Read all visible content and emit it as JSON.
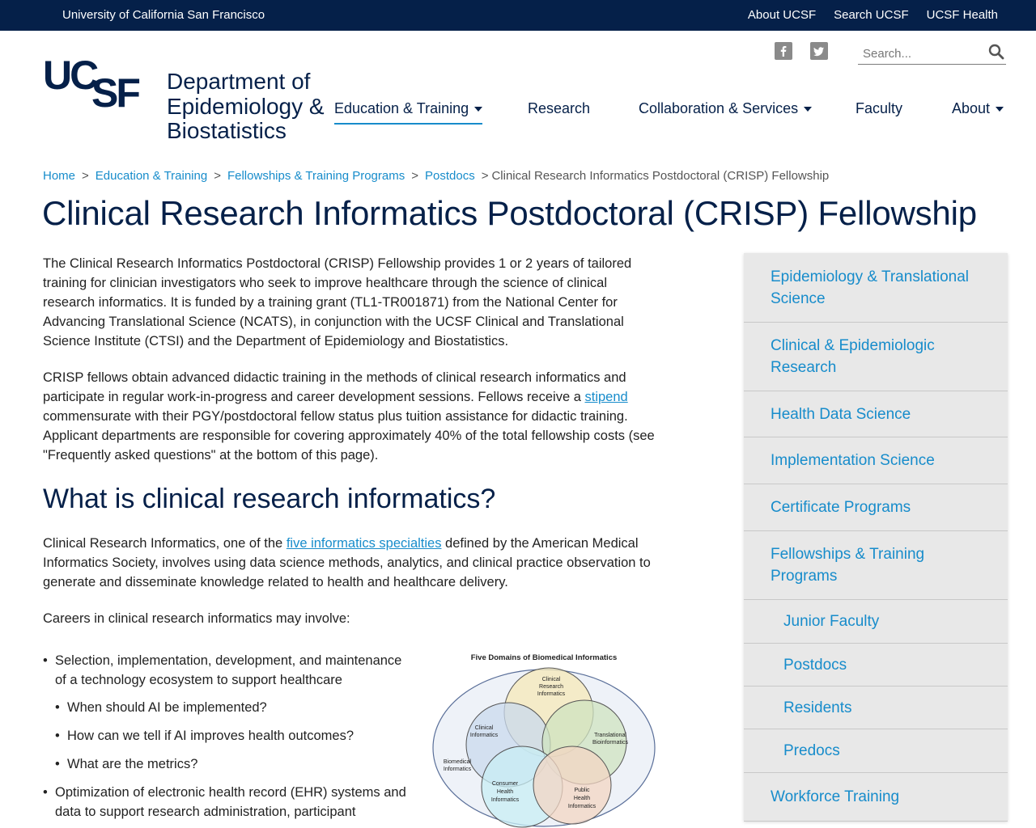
{
  "topbar": {
    "university": "University of California San Francisco",
    "links": [
      "About UCSF",
      "Search UCSF",
      "UCSF Health"
    ]
  },
  "header": {
    "logo_text": "UCSF",
    "department": "Department of\nEpidemiology &\nBiostatistics",
    "search_placeholder": "Search...",
    "social": [
      "facebook-icon",
      "twitter-icon"
    ]
  },
  "nav": {
    "items": [
      {
        "label": "Education & Training",
        "dropdown": true,
        "active": true
      },
      {
        "label": "Research",
        "dropdown": false
      },
      {
        "label": "Collaboration & Services",
        "dropdown": true
      },
      {
        "label": "Faculty",
        "dropdown": false
      },
      {
        "label": "About",
        "dropdown": true
      }
    ]
  },
  "breadcrumb": {
    "links": [
      "Home",
      "Education & Training",
      "Fellowships & Training Programs",
      "Postdocs"
    ],
    "current": "Clinical Research Informatics Postdoctoral (CRISP) Fellowship"
  },
  "page_title": "Clinical Research Informatics Postdoctoral (CRISP) Fellowship",
  "content": {
    "p1": "The Clinical Research Informatics Postdoctoral (CRISP) Fellowship provides 1 or 2 years of tailored training for clinician investigators who seek to improve healthcare through the science of clinical research informatics. It is funded by a training grant (TL1-TR001871) from the National Center for Advancing Translational Science (NCATS), in conjunction with the UCSF Clinical and Translational Science Institute (CTSI) and the Department of Epidemiology and Biostatistics.",
    "p2_before": "CRISP fellows obtain advanced didactic training in the methods of clinical research informatics and participate in regular work-in-progress and career development sessions. Fellows receive a ",
    "p2_link": "stipend",
    "p2_after": " commensurate with their PGY/postdoctoral fellow status plus tuition assistance for didactic training. Applicant departments are responsible for covering approximately 40% of the total fellowship costs (see \"Frequently asked questions\" at the bottom of this page).",
    "h2": "What is clinical research informatics?",
    "p3_before": "Clinical Research Informatics, one of the ",
    "p3_link": "five informatics specialties",
    "p3_after": " defined by the American Medical Informatics Society, involves using data science methods, analytics, and clinical practice observation to generate and disseminate knowledge related to health and healthcare delivery.",
    "p4": "Careers in clinical research informatics may involve:",
    "bullet1": "Selection, implementation, development, and maintenance of a technology ecosystem to support healthcare",
    "sub_bullets": [
      "When should AI be implemented?",
      "How can we tell if AI improves health outcomes?",
      "What are the metrics?"
    ],
    "bullet2": "Optimization of electronic health record (EHR) systems and data to support research administration, participant"
  },
  "figure": {
    "title": "Five Domains of Biomedical Informatics",
    "labels": {
      "cri": "Clinical\nResearch\nInformatics",
      "ci": "Clinical\nInformatics",
      "tb": "Translational\nBioinformatics",
      "bi": "Biomedical\nInformatics",
      "chi": "Consumer\nHealth\nInformatics",
      "phi": "Public\nHealth\nInformatics"
    }
  },
  "sidebar": {
    "items": [
      {
        "label": "Epidemiology & Translational Science",
        "sub": false
      },
      {
        "label": "Clinical & Epidemiologic Research",
        "sub": false
      },
      {
        "label": "Health Data Science",
        "sub": false
      },
      {
        "label": "Implementation Science",
        "sub": false
      },
      {
        "label": "Certificate Programs",
        "sub": false
      },
      {
        "label": "Fellowships & Training Programs",
        "sub": false
      },
      {
        "label": "Junior Faculty",
        "sub": true
      },
      {
        "label": "Postdocs",
        "sub": true
      },
      {
        "label": "Residents",
        "sub": true
      },
      {
        "label": "Predocs",
        "sub": true
      },
      {
        "label": "Workforce Training",
        "sub": false
      }
    ]
  },
  "colors": {
    "navy": "#052049",
    "link": "#178ccb",
    "sidebar_bg": "#e8e8e8"
  }
}
